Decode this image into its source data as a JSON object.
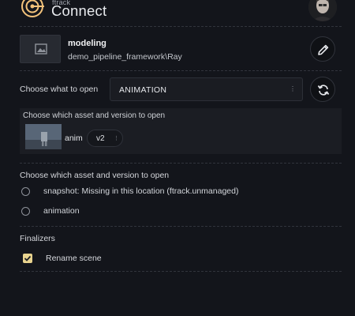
{
  "header": {
    "brand_small": "ftrack",
    "brand_large": "Connect"
  },
  "context": {
    "title": "modeling",
    "path": "demo_pipeline_framework\\Ray"
  },
  "open": {
    "label": "Choose what to open",
    "selected": "ANIMATION"
  },
  "asset_panel": {
    "label": "Choose which asset and version to open",
    "asset_name": "anim",
    "version": "v2"
  },
  "components": {
    "label": "Choose which asset and version to open",
    "options": [
      {
        "label": "snapshot: Missing in this location (ftrack.unmanaged)",
        "selected": false
      },
      {
        "label": "animation",
        "selected": false
      }
    ]
  },
  "finalizers": {
    "label": "Finalizers",
    "items": [
      {
        "label": "Rename scene",
        "checked": true
      }
    ]
  },
  "colors": {
    "background": "#13151b",
    "panel": "#1b1d23",
    "checkbox_accent": "#e8d38e"
  }
}
